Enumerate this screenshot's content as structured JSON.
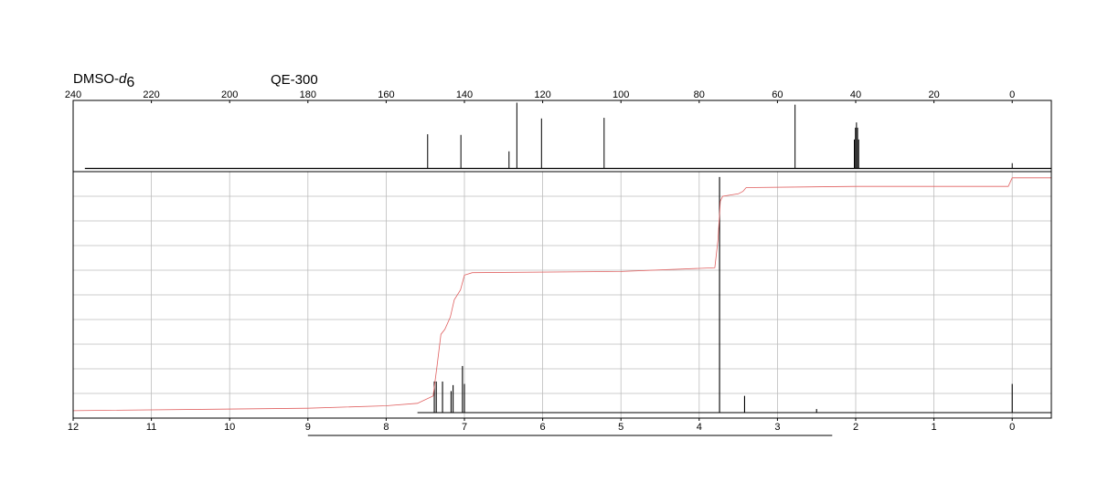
{
  "header": {
    "solvent_prefix": "DMSO-",
    "solvent_italic": "d",
    "solvent_subscript": "6",
    "instrument": "QE-300"
  },
  "chart_data": [
    {
      "type": "line",
      "title": "",
      "xlabel": "",
      "ylabel": "",
      "x_direction": "descending",
      "xlim": [
        240,
        -10
      ],
      "ylim": [
        0,
        1
      ],
      "grid": false,
      "tick_labels": [
        "240",
        "220",
        "200",
        "180",
        "160",
        "140",
        "120",
        "100",
        "80",
        "60",
        "40",
        "20",
        "0"
      ],
      "tick_values": [
        240,
        220,
        200,
        180,
        160,
        140,
        120,
        100,
        80,
        60,
        40,
        20,
        0
      ],
      "baseline_range": [
        237,
        -10
      ],
      "peaks": [
        {
          "x": 149.4,
          "y": 0.52
        },
        {
          "x": 140.9,
          "y": 0.51
        },
        {
          "x": 128.6,
          "y": 0.26
        },
        {
          "x": 126.6,
          "y": 1.0
        },
        {
          "x": 120.3,
          "y": 0.76
        },
        {
          "x": 104.3,
          "y": 0.77
        },
        {
          "x": 55.5,
          "y": 0.97
        },
        {
          "x": 40.35,
          "y": 0.44
        },
        {
          "x": 40.07,
          "y": 0.62
        },
        {
          "x": 39.8,
          "y": 0.7
        },
        {
          "x": 39.52,
          "y": 0.62
        },
        {
          "x": 39.24,
          "y": 0.44
        },
        {
          "x": 0.0,
          "y": 0.08
        }
      ]
    },
    {
      "type": "line",
      "title": "",
      "xlabel": "",
      "ylabel": "",
      "x_direction": "descending",
      "xlim": [
        12,
        -0.5
      ],
      "ylim": [
        0,
        1
      ],
      "grid": true,
      "grid_x": [
        11,
        10,
        9,
        8,
        7,
        6,
        5,
        4,
        3,
        2,
        1,
        0
      ],
      "grid_y_count": 10,
      "tick_labels": [
        "12",
        "11",
        "10",
        "9",
        "8",
        "7",
        "6",
        "5",
        "4",
        "3",
        "2",
        "1",
        "0"
      ],
      "tick_values": [
        12,
        11,
        10,
        9,
        8,
        7,
        6,
        5,
        4,
        3,
        2,
        1,
        0
      ],
      "scale_bar_range": [
        9,
        2.3
      ],
      "peaks": [
        {
          "x": 7.385,
          "y": 0.13
        },
        {
          "x": 7.36,
          "y": 0.13
        },
        {
          "x": 7.28,
          "y": 0.13
        },
        {
          "x": 7.17,
          "y": 0.09
        },
        {
          "x": 7.145,
          "y": 0.115
        },
        {
          "x": 7.025,
          "y": 0.195
        },
        {
          "x": 7.0,
          "y": 0.12
        },
        {
          "x": 3.74,
          "y": 0.985
        },
        {
          "x": 3.42,
          "y": 0.07
        },
        {
          "x": 2.5,
          "y": 0.015
        },
        {
          "x": 0.0,
          "y": 0.12
        }
      ],
      "integral": [
        {
          "x": 12.0,
          "y": 0.03
        },
        {
          "x": 9.0,
          "y": 0.04
        },
        {
          "x": 8.0,
          "y": 0.05
        },
        {
          "x": 7.6,
          "y": 0.06
        },
        {
          "x": 7.4,
          "y": 0.09
        },
        {
          "x": 7.35,
          "y": 0.21
        },
        {
          "x": 7.3,
          "y": 0.34
        },
        {
          "x": 7.25,
          "y": 0.36
        },
        {
          "x": 7.18,
          "y": 0.41
        },
        {
          "x": 7.13,
          "y": 0.48
        },
        {
          "x": 7.05,
          "y": 0.52
        },
        {
          "x": 7.0,
          "y": 0.58
        },
        {
          "x": 6.9,
          "y": 0.59
        },
        {
          "x": 5.0,
          "y": 0.595
        },
        {
          "x": 3.8,
          "y": 0.61
        },
        {
          "x": 3.76,
          "y": 0.72
        },
        {
          "x": 3.73,
          "y": 0.88
        },
        {
          "x": 3.7,
          "y": 0.9
        },
        {
          "x": 3.5,
          "y": 0.91
        },
        {
          "x": 3.44,
          "y": 0.92
        },
        {
          "x": 3.4,
          "y": 0.935
        },
        {
          "x": 2.0,
          "y": 0.94
        },
        {
          "x": 0.05,
          "y": 0.94
        },
        {
          "x": 0.0,
          "y": 0.975
        },
        {
          "x": -0.5,
          "y": 0.975
        }
      ]
    }
  ],
  "colors": {
    "spectrum": "#000000",
    "integral": "#e06060",
    "grid": "#bdbdbd",
    "frame": "#000000"
  }
}
